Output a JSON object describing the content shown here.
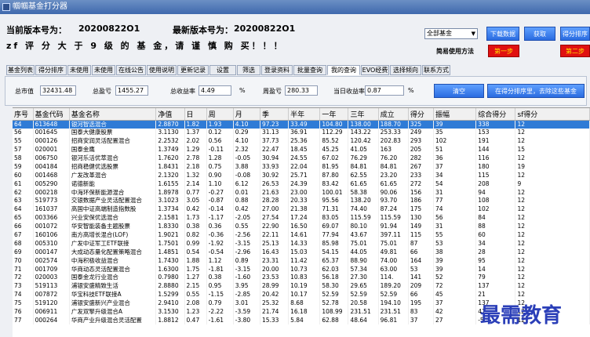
{
  "title": "帼帼基金打分器",
  "header": {
    "current_version_label": "当前版本号为：",
    "current_version": "20200822O1",
    "latest_version_label": "最新版本号为：",
    "latest_version": "20200822O1",
    "warning": "zf 评 分 大 于 9 级 的 基 金，请 谨 慎 购 买！！！"
  },
  "controls": {
    "fund_type": "全部基金",
    "download_btn": "下载数据",
    "fetch_btn": "获取",
    "score_btn": "得分排序",
    "guide": "简易使用方法",
    "step1": "第一步",
    "step2": "第二步"
  },
  "tabs": [
    "基金列表",
    "得分排序",
    "未使用",
    "未使用",
    "在线公告",
    "使用说明",
    "更新记录",
    "设置",
    "筛选",
    "登录资料",
    "批量查询",
    "我的查询",
    "EVO经费",
    "选择倾向",
    "联系方式"
  ],
  "filter": {
    "total_assets_label": "总市值",
    "total_assets": "32431.48",
    "total_profit_label": "总盈亏",
    "total_profit": "1455.27",
    "total_yield_label": "总收益率",
    "total_yield": "4.49",
    "percent1": "%",
    "weekly_label": "周盈亏",
    "weekly": "280.33",
    "daily_label": "当日收益率",
    "daily": "0.87",
    "percent2": "%",
    "clear_btn": "清空",
    "add_btn": "在得分排序里，去除这些基金"
  },
  "table": {
    "headers": [
      "序号",
      "基金代码",
      "基金名称",
      "净值",
      "日",
      "周",
      "月",
      "季",
      "半年",
      "一年",
      "三年",
      "成立",
      "得分",
      "振幅",
      "综合得分",
      "sf得分"
    ],
    "rows": [
      [
        "64",
        "613648",
        "银河智选混合",
        "2.8870",
        "1.82",
        "1.93",
        "4.10",
        "97.23",
        "33.49",
        "104.80",
        "138.00",
        "188.70",
        "325",
        "39",
        "338",
        "12"
      ],
      [
        "56",
        "001645",
        "国泰大健康股票",
        "3.1130",
        "1.37",
        "0.12",
        "0.29",
        "31.13",
        "36.91",
        "112.29",
        "143.22",
        "253.33",
        "249",
        "35",
        "153",
        "12"
      ],
      [
        "55",
        "000126",
        "招商安润灵活配置混合",
        "2.2532",
        "2.02",
        "0.56",
        "4.10",
        "37.73",
        "25.36",
        "85.52",
        "120.42",
        "202.83",
        "293",
        "102",
        "191",
        "12"
      ],
      [
        "57",
        "020001",
        "国泰金鹰",
        "1.3749",
        "1.29",
        "-0.11",
        "2.32",
        "22.47",
        "18.45",
        "45.25",
        "41.05",
        "163",
        "205",
        "51",
        "144",
        "15"
      ],
      [
        "58",
        "006750",
        "银河乐活优萃混合",
        "1.7620",
        "2.78",
        "1.28",
        "-0.05",
        "30.94",
        "24.55",
        "67.02",
        "76.29",
        "76.20",
        "282",
        "36",
        "116",
        "12"
      ],
      [
        "59",
        "004184",
        "招商稳健优选股票",
        "1.8431",
        "2.18",
        "0.75",
        "3.88",
        "33.93",
        "22.04",
        "81.95",
        "84.81",
        "84.81",
        "267",
        "37",
        "180",
        "19"
      ],
      [
        "60",
        "001468",
        "广发改革混合",
        "2.1320",
        "1.32",
        "0.90",
        "-0.08",
        "30.92",
        "25.71",
        "87.80",
        "62.55",
        "23.20",
        "233",
        "34",
        "115",
        "12"
      ],
      [
        "61",
        "005290",
        "诺德新能",
        "1.6155",
        "2.14",
        "1.10",
        "6.12",
        "26.53",
        "24.39",
        "83.42",
        "61.65",
        "61.65",
        "272",
        "54",
        "208",
        "9"
      ],
      [
        "62",
        "000218",
        "中海环保新能源混合",
        "1.8978",
        "0.77",
        "-0.27",
        "0.01",
        "21.63",
        "23.00",
        "100.01",
        "58.38",
        "90.06",
        "156",
        "31",
        "94",
        "12"
      ],
      [
        "63",
        "519773",
        "交银数据产业灵活配置混合",
        "3.1023",
        "3.05",
        "-0.87",
        "0.88",
        "28.28",
        "20.33",
        "95.56",
        "138.20",
        "93.70",
        "186",
        "77",
        "108",
        "12"
      ],
      [
        "64",
        "161037",
        "高国中证高端制造指数股",
        "1.3734",
        "0.42",
        "-0.14",
        "0.42",
        "27.00",
        "21.38",
        "71.31",
        "74.40",
        "87.24",
        "175",
        "74",
        "102",
        "12"
      ],
      [
        "65",
        "003366",
        "兴业安保优选混合",
        "2.1581",
        "1.73",
        "-1.17",
        "-2.05",
        "27.54",
        "17.24",
        "83.05",
        "115.59",
        "115.59",
        "130",
        "56",
        "84",
        "12"
      ],
      [
        "66",
        "001072",
        "华安智能装备主题股票",
        "1.8330",
        "0.38",
        "0.36",
        "0.55",
        "22.90",
        "16.50",
        "69.07",
        "80.10",
        "91.94",
        "149",
        "31",
        "88",
        "12"
      ],
      [
        "67",
        "160106",
        "南方高增长混合(LOF)",
        "1.9021",
        "0.82",
        "-0.36",
        "-2.56",
        "22.11",
        "14.61",
        "77.94",
        "43.67",
        "397.11",
        "115",
        "55",
        "60",
        "12"
      ],
      [
        "68",
        "005310",
        "广发中证军工ETF联接",
        "1.7501",
        "0.99",
        "-1.92",
        "-3.15",
        "25.13",
        "14.33",
        "85.98",
        "75.01",
        "75.01",
        "87",
        "53",
        "34",
        "12"
      ],
      [
        "69",
        "000147",
        "大成动态量化配置策略混合",
        "1.4851",
        "0.54",
        "-0.54",
        "-2.96",
        "16.43",
        "15.03",
        "54.15",
        "44.05",
        "49.81",
        "66",
        "38",
        "28",
        "12"
      ],
      [
        "70",
        "002574",
        "中海积极收益混合",
        "1.7430",
        "1.88",
        "1.12",
        "0.89",
        "23.31",
        "11.42",
        "65.37",
        "88.90",
        "74.00",
        "164",
        "39",
        "95",
        "12"
      ],
      [
        "71",
        "001709",
        "华商动态灵活配置混合",
        "1.6300",
        "1.75",
        "-1.81",
        "-3.15",
        "20.00",
        "10.73",
        "62.03",
        "57.34",
        "63.00",
        "53",
        "39",
        "14",
        "12"
      ],
      [
        "72",
        "020003",
        "国泰金龙行业混合",
        "0.7980",
        "1.27",
        "0.38",
        "-1.60",
        "23.53",
        "10.83",
        "56.18",
        "27.30",
        "114.",
        "141",
        "52",
        "79",
        "12"
      ],
      [
        "73",
        "519113",
        "浦银安盛精致生活",
        "2.8880",
        "2.15",
        "0.95",
        "3.95",
        "28.99",
        "10.19",
        "58.30",
        "29.65",
        "189.20",
        "209",
        "72",
        "137",
        "12"
      ],
      [
        "74",
        "007872",
        "华宝科技ETF联接A",
        "1.5299",
        "0.55",
        "-1.15",
        "-2.85",
        "20.42",
        "10.17",
        "52.59",
        "52.59",
        "52.59",
        "66",
        "45",
        "21",
        "12"
      ],
      [
        "75",
        "519120",
        "浦银安盛新兴产业混合",
        "2.9410",
        "2.08",
        "0.79",
        "3.01",
        "25.32",
        "8.68",
        "52.78",
        "20.58",
        "194.10",
        "195",
        "37",
        "137",
        "12"
      ],
      [
        "76",
        "006911",
        "广发双擎升级混合A",
        "3.1530",
        "1.23",
        "-2.22",
        "-3.59",
        "21.74",
        "16.18",
        "108.99",
        "231.51",
        "231.51",
        "83",
        "42",
        "41",
        "12"
      ],
      [
        "77",
        "000264",
        "华商产业升级混合灵活配置",
        "1.8812",
        "0.47",
        "-1.61",
        "-3.80",
        "15.33",
        "5.84",
        "62.88",
        "48.64",
        "96.81",
        "37",
        "27",
        "-5",
        "12"
      ]
    ]
  },
  "watermark": "最需教育"
}
